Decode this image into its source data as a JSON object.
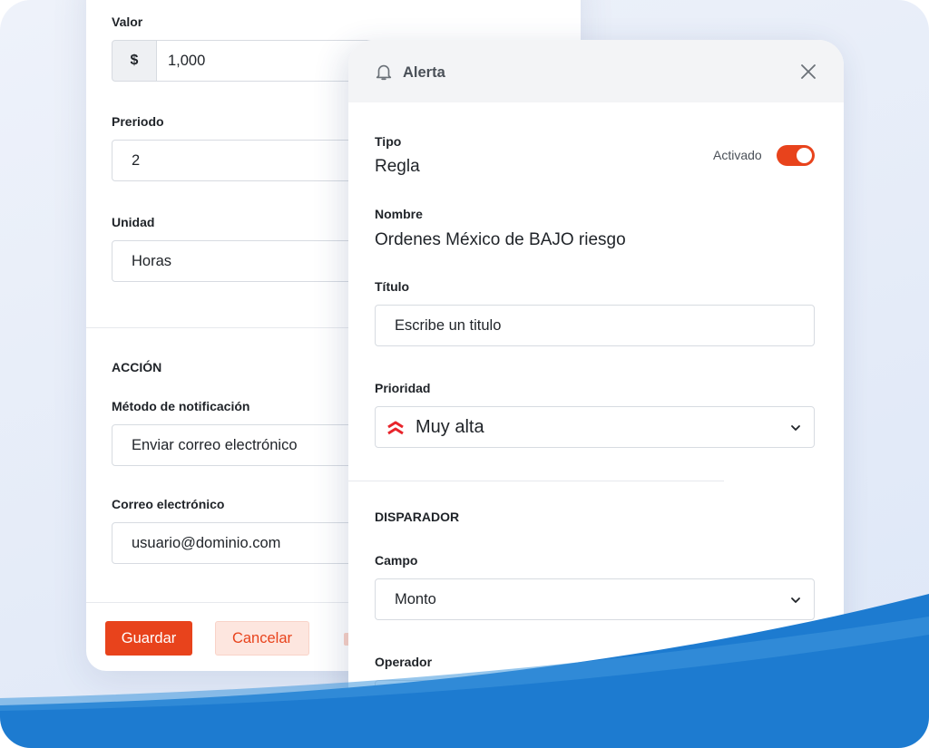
{
  "back_form": {
    "valor": {
      "label": "Valor",
      "prefix": "$",
      "value": "1,000"
    },
    "periodo": {
      "label": "Preriodo",
      "value": "2"
    },
    "unidad": {
      "label": "Unidad",
      "value": "Horas"
    },
    "accion_section": "ACCIÓN",
    "metodo": {
      "label": "Método de notificación",
      "value": "Enviar correo electrónico"
    },
    "correo": {
      "label": "Correo electrónico",
      "value": "usuario@dominio.com"
    },
    "save_label": "Guardar",
    "cancel_label": "Cancelar"
  },
  "alert_panel": {
    "title": "Alerta",
    "header_icon": "bell-icon",
    "close_icon": "close-icon",
    "tipo": {
      "label": "Tipo",
      "value": "Regla"
    },
    "toggle": {
      "label": "Activado",
      "on": true
    },
    "nombre": {
      "label": "Nombre",
      "value": "Ordenes México de BAJO riesgo"
    },
    "titulo": {
      "label": "Título",
      "placeholder": "Escribe un titulo"
    },
    "prioridad": {
      "label": "Prioridad",
      "value": "Muy alta",
      "icon": "double-chevron-up-icon"
    },
    "disparador_section": "DISPARADOR",
    "campo": {
      "label": "Campo",
      "value": "Monto"
    },
    "operador": {
      "label": "Operador"
    }
  },
  "colors": {
    "accent": "#e8431c",
    "accent_soft": "#fde6df",
    "wave": "#1d7bd0",
    "wave_light": "#3f97dd"
  }
}
